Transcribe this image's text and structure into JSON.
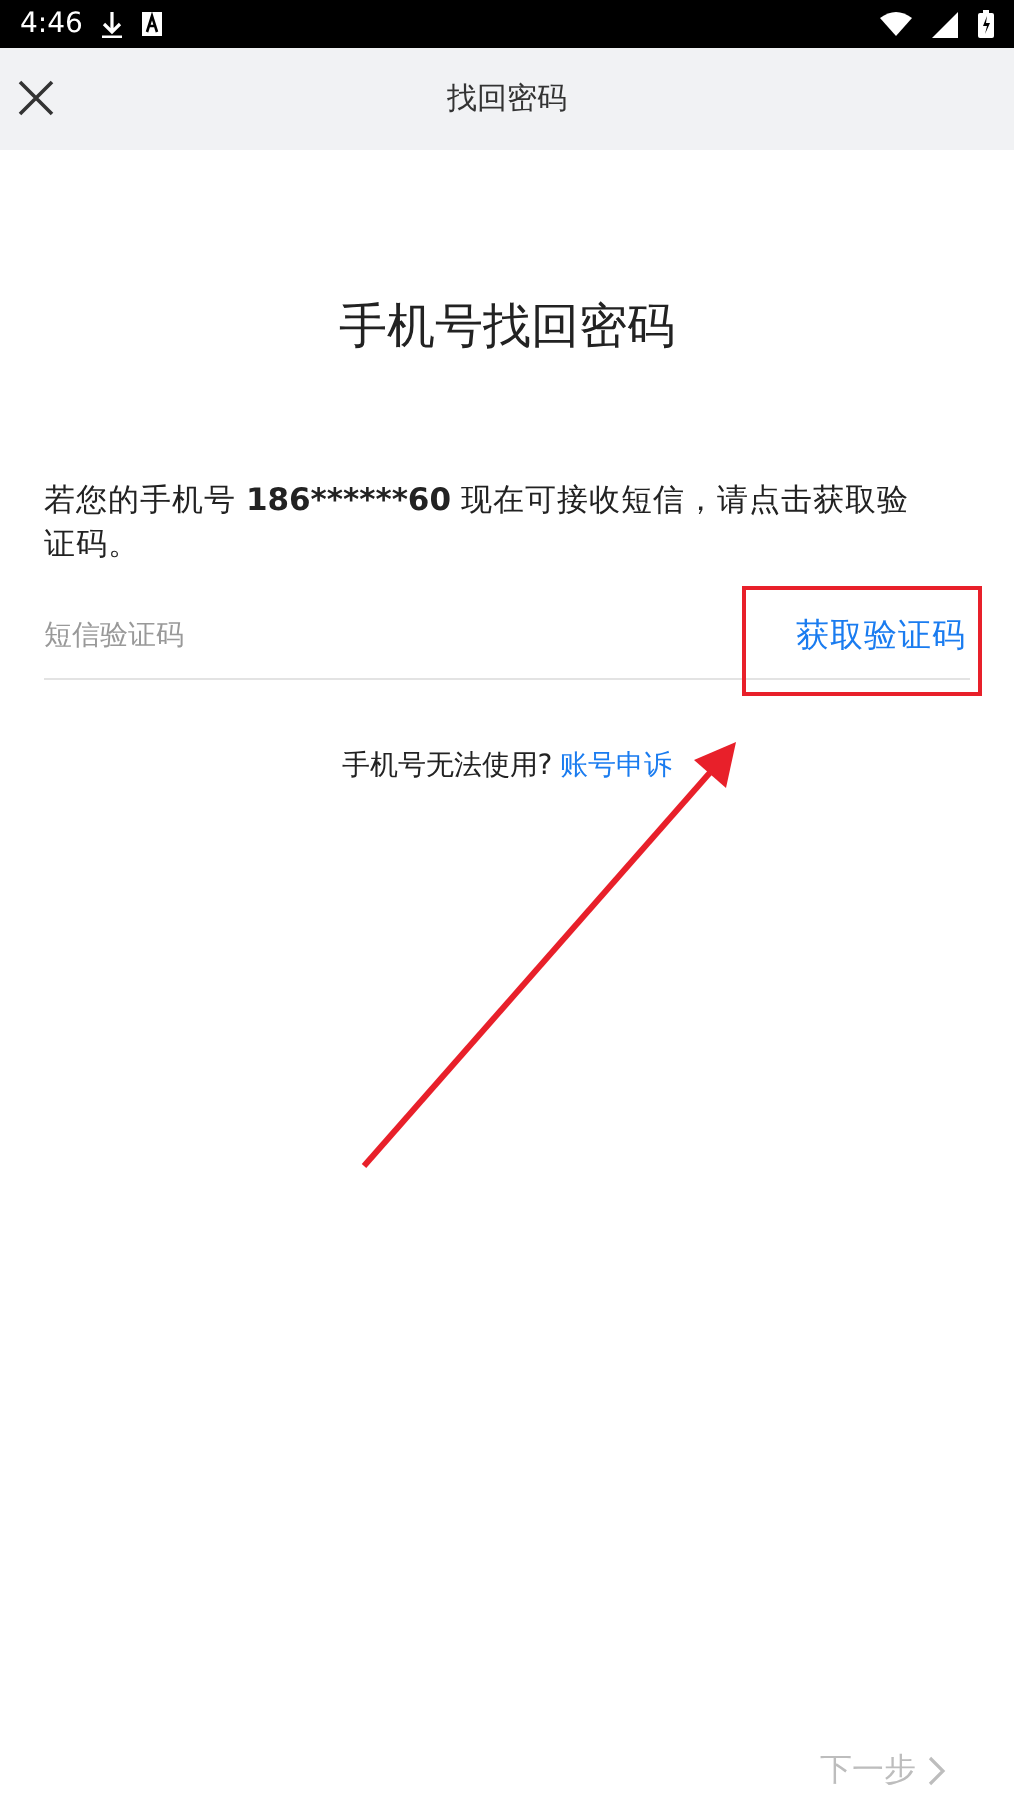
{
  "status_bar": {
    "time": "4:46"
  },
  "header": {
    "title": "找回密码"
  },
  "heading": "手机号找回密码",
  "instruction": {
    "text_before": "若您的手机号 ",
    "phone": "186******60",
    "text_after": " 现在可接收短信，请点击获取验证码。"
  },
  "code_field": {
    "placeholder": "短信验证码",
    "action": "获取验证码"
  },
  "help": {
    "text": "手机号无法使用?",
    "link": "账号申诉"
  },
  "next_button": {
    "label": "下一步",
    "disabled": true
  }
}
